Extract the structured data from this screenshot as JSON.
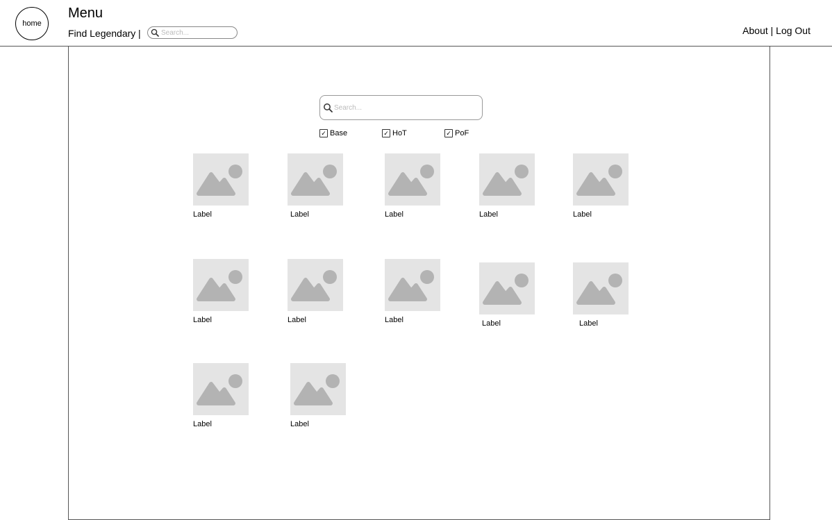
{
  "header": {
    "home_label": "home",
    "menu_title": "Menu",
    "find_link": "Find Legendary",
    "separator": "|",
    "search_placeholder": "Search...",
    "about_label": "About",
    "links_separator": "|",
    "logout_label": "Log Out"
  },
  "main": {
    "search_placeholder": "Search...",
    "filters": [
      {
        "label": "Base",
        "checked": true
      },
      {
        "label": "HoT",
        "checked": true
      },
      {
        "label": "PoF",
        "checked": true
      }
    ],
    "items": [
      {
        "label": "Label"
      },
      {
        "label": "Label"
      },
      {
        "label": "Label"
      },
      {
        "label": "Label"
      },
      {
        "label": "Label"
      },
      {
        "label": "Label"
      },
      {
        "label": "Label"
      },
      {
        "label": "Label"
      },
      {
        "label": "Label"
      },
      {
        "label": "Label"
      },
      {
        "label": "Label"
      },
      {
        "label": "Label"
      }
    ]
  },
  "icons": {
    "search": "search-icon",
    "image_placeholder": "image-placeholder-icon",
    "checkbox_mark": "check-icon"
  },
  "colors": {
    "placeholder_bg": "#e4e4e4",
    "placeholder_glyph": "#b3b3b3",
    "border": "#555555"
  }
}
